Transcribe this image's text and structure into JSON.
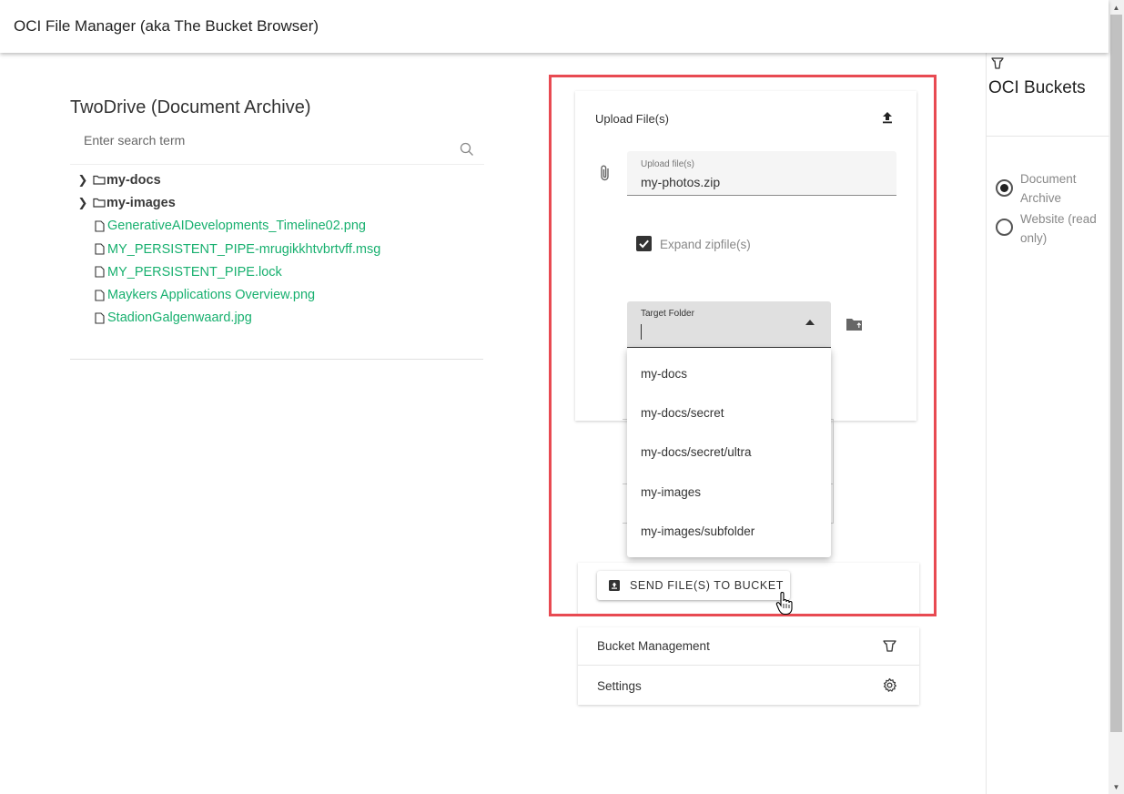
{
  "app": {
    "title": "OCI File Manager (aka The Bucket Browser)"
  },
  "archive": {
    "title": "TwoDrive (Document Archive)",
    "search_placeholder": "Enter search term",
    "folders": [
      "my-docs",
      "my-images"
    ],
    "files": [
      "GenerativeAIDevelopments_Timeline02.png",
      "MY_PERSISTENT_PIPE-mrugikkhtvbrtvff.msg",
      "MY_PERSISTENT_PIPE.lock",
      "Maykers Applications Overview.png",
      "StadionGalgenwaard.jpg"
    ]
  },
  "upload": {
    "title": "Upload File(s)",
    "file_label": "Upload file(s)",
    "file_value": "my-photos.zip",
    "expand_label": "Expand zipfile(s)",
    "expand_checked": true,
    "target_label": "Target Folder",
    "target_options": [
      "my-docs",
      "my-docs/secret",
      "my-docs/secret/ultra",
      "my-images",
      "my-images/subfolder"
    ],
    "send_label": "SEND FILE(S) TO BUCKET"
  },
  "menu": {
    "items": [
      {
        "label": "Bucket Management",
        "icon": "bucket-icon"
      },
      {
        "label": "Settings",
        "icon": "gear-icon"
      }
    ]
  },
  "buckets": {
    "title": "OCI Buckets",
    "options": [
      {
        "label": "Document Archive",
        "checked": true
      },
      {
        "label": "Website (read only)",
        "checked": false
      }
    ]
  },
  "colors": {
    "file_link": "#18b06f",
    "highlight": "#e84a52"
  }
}
